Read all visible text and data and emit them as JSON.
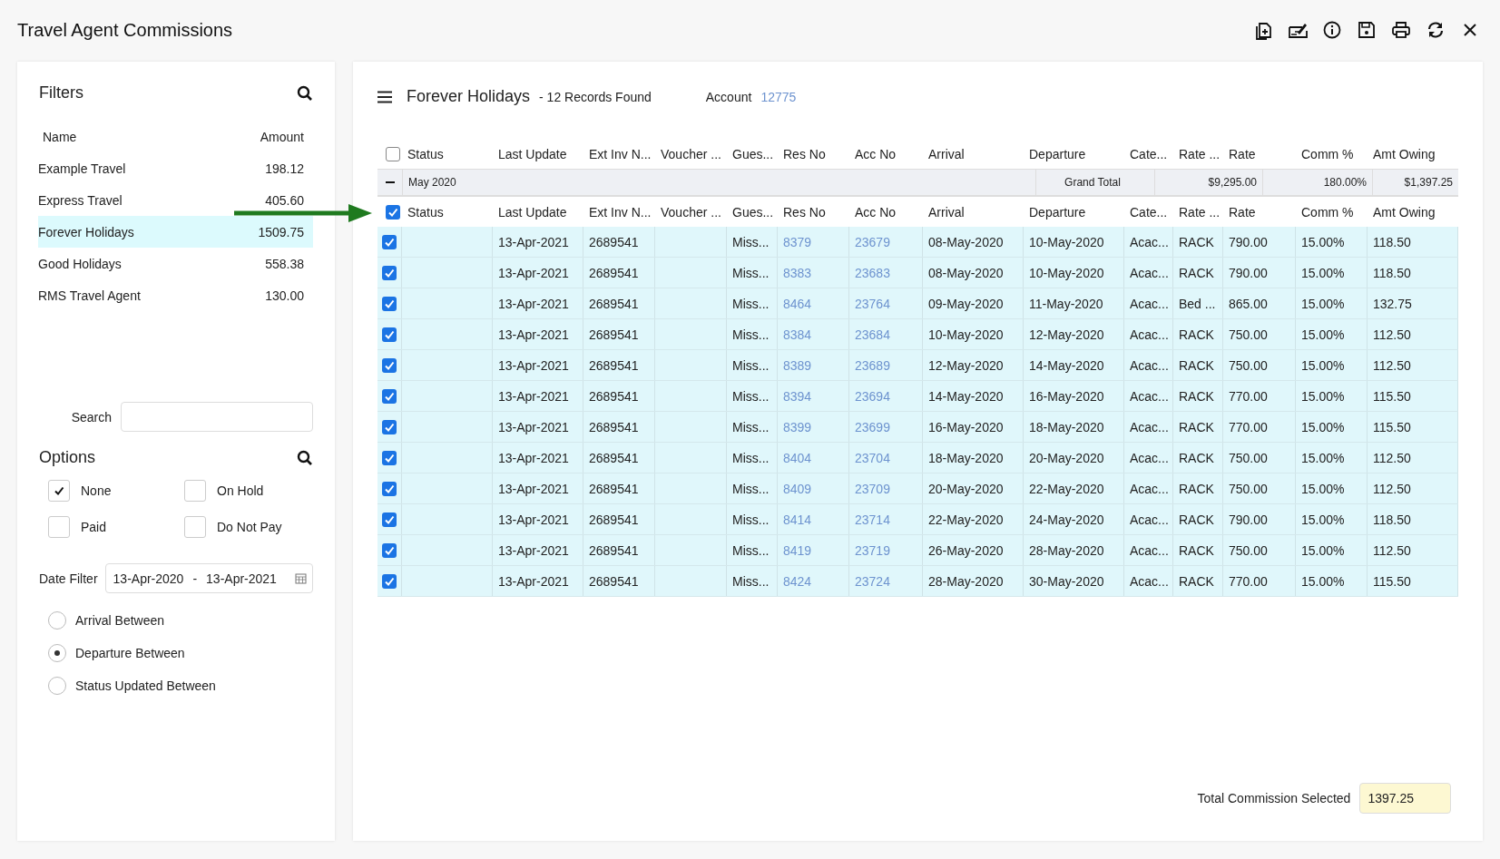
{
  "window": {
    "title": "Travel Agent Commissions"
  },
  "filters": {
    "title": "Filters",
    "columns": [
      "Name",
      "Amount"
    ],
    "items": [
      {
        "name": "Example Travel",
        "amount": "198.12",
        "selected": false
      },
      {
        "name": "Express Travel",
        "amount": "405.60",
        "selected": false
      },
      {
        "name": "Forever Holidays",
        "amount": "1509.75",
        "selected": true
      },
      {
        "name": "Good Holidays",
        "amount": "558.38",
        "selected": false
      },
      {
        "name": "RMS Travel Agent",
        "amount": "130.00",
        "selected": false
      }
    ],
    "search": {
      "label": "Search"
    },
    "options": {
      "title": "Options",
      "items": [
        {
          "label": "None",
          "checked": true
        },
        {
          "label": "On Hold",
          "checked": false
        },
        {
          "label": "Paid",
          "checked": false
        },
        {
          "label": "Do Not Pay",
          "checked": false
        }
      ]
    },
    "date_filter": {
      "label": "Date Filter",
      "from": "13-Apr-2020",
      "separator": "-",
      "to": "13-Apr-2021"
    },
    "date_modes": [
      {
        "label": "Arrival Between",
        "selected": false
      },
      {
        "label": "Departure Between",
        "selected": true
      },
      {
        "label": "Status Updated Between",
        "selected": false
      }
    ]
  },
  "main": {
    "title": "Forever Holidays",
    "subtitle": "- 12 Records Found",
    "account_label": "Account",
    "account_value": "12775"
  },
  "table": {
    "header_checked": false,
    "columns": [
      "Status",
      "Last Update",
      "Ext Inv N...",
      "Voucher ...",
      "Gues...",
      "Res No",
      "Acc No",
      "Arrival",
      "Departure",
      "Cate...",
      "Rate ...",
      "Rate",
      "Comm %",
      "Amt Owing"
    ],
    "group": {
      "columns": [
        "Status",
        "Last Update",
        "Ext Inv N...",
        "Voucher ...",
        "Gues...",
        "Res No",
        "Acc No",
        "Arrival",
        "Departure",
        "Cate...",
        "Rate ...",
        "Rate",
        "Comm %",
        "Amt Owing"
      ],
      "label": "May 2020",
      "expanded": true,
      "checked": true,
      "grand_total_label": "Grand Total",
      "rate_total": "$9,295.00",
      "comm_total": "180.00%",
      "amt_total": "$1,397.25"
    },
    "rows": [
      {
        "checked": true,
        "last_update": "13-Apr-2021",
        "ext_inv": "2689541",
        "guest": "Miss...",
        "res_no": "8379",
        "acc_no": "23679",
        "arrival": "08-May-2020",
        "departure": "10-May-2020",
        "category": "Acac...",
        "rate_type": "RACK",
        "rate": "790.00",
        "comm": "15.00%",
        "amt": "118.50"
      },
      {
        "checked": true,
        "last_update": "13-Apr-2021",
        "ext_inv": "2689541",
        "guest": "Miss...",
        "res_no": "8383",
        "acc_no": "23683",
        "arrival": "08-May-2020",
        "departure": "10-May-2020",
        "category": "Acac...",
        "rate_type": "RACK",
        "rate": "790.00",
        "comm": "15.00%",
        "amt": "118.50"
      },
      {
        "checked": true,
        "last_update": "13-Apr-2021",
        "ext_inv": "2689541",
        "guest": "Miss...",
        "res_no": "8464",
        "acc_no": "23764",
        "arrival": "09-May-2020",
        "departure": "11-May-2020",
        "category": "Acac...",
        "rate_type": "Bed ...",
        "rate": "865.00",
        "comm": "15.00%",
        "amt": "132.75"
      },
      {
        "checked": true,
        "last_update": "13-Apr-2021",
        "ext_inv": "2689541",
        "guest": "Miss...",
        "res_no": "8384",
        "acc_no": "23684",
        "arrival": "10-May-2020",
        "departure": "12-May-2020",
        "category": "Acac...",
        "rate_type": "RACK",
        "rate": "750.00",
        "comm": "15.00%",
        "amt": "112.50"
      },
      {
        "checked": true,
        "last_update": "13-Apr-2021",
        "ext_inv": "2689541",
        "guest": "Miss...",
        "res_no": "8389",
        "acc_no": "23689",
        "arrival": "12-May-2020",
        "departure": "14-May-2020",
        "category": "Acac...",
        "rate_type": "RACK",
        "rate": "750.00",
        "comm": "15.00%",
        "amt": "112.50"
      },
      {
        "checked": true,
        "last_update": "13-Apr-2021",
        "ext_inv": "2689541",
        "guest": "Miss...",
        "res_no": "8394",
        "acc_no": "23694",
        "arrival": "14-May-2020",
        "departure": "16-May-2020",
        "category": "Acac...",
        "rate_type": "RACK",
        "rate": "770.00",
        "comm": "15.00%",
        "amt": "115.50"
      },
      {
        "checked": true,
        "last_update": "13-Apr-2021",
        "ext_inv": "2689541",
        "guest": "Miss...",
        "res_no": "8399",
        "acc_no": "23699",
        "arrival": "16-May-2020",
        "departure": "18-May-2020",
        "category": "Acac...",
        "rate_type": "RACK",
        "rate": "770.00",
        "comm": "15.00%",
        "amt": "115.50"
      },
      {
        "checked": true,
        "last_update": "13-Apr-2021",
        "ext_inv": "2689541",
        "guest": "Miss...",
        "res_no": "8404",
        "acc_no": "23704",
        "arrival": "18-May-2020",
        "departure": "20-May-2020",
        "category": "Acac...",
        "rate_type": "RACK",
        "rate": "750.00",
        "comm": "15.00%",
        "amt": "112.50"
      },
      {
        "checked": true,
        "last_update": "13-Apr-2021",
        "ext_inv": "2689541",
        "guest": "Miss...",
        "res_no": "8409",
        "acc_no": "23709",
        "arrival": "20-May-2020",
        "departure": "22-May-2020",
        "category": "Acac...",
        "rate_type": "RACK",
        "rate": "750.00",
        "comm": "15.00%",
        "amt": "112.50"
      },
      {
        "checked": true,
        "last_update": "13-Apr-2021",
        "ext_inv": "2689541",
        "guest": "Miss...",
        "res_no": "8414",
        "acc_no": "23714",
        "arrival": "22-May-2020",
        "departure": "24-May-2020",
        "category": "Acac...",
        "rate_type": "RACK",
        "rate": "790.00",
        "comm": "15.00%",
        "amt": "118.50"
      },
      {
        "checked": true,
        "last_update": "13-Apr-2021",
        "ext_inv": "2689541",
        "guest": "Miss...",
        "res_no": "8419",
        "acc_no": "23719",
        "arrival": "26-May-2020",
        "departure": "28-May-2020",
        "category": "Acac...",
        "rate_type": "RACK",
        "rate": "750.00",
        "comm": "15.00%",
        "amt": "112.50"
      },
      {
        "checked": true,
        "last_update": "13-Apr-2021",
        "ext_inv": "2689541",
        "guest": "Miss...",
        "res_no": "8424",
        "acc_no": "23724",
        "arrival": "28-May-2020",
        "departure": "30-May-2020",
        "category": "Acac...",
        "rate_type": "RACK",
        "rate": "770.00",
        "comm": "15.00%",
        "amt": "115.50"
      }
    ]
  },
  "footer": {
    "label": "Total Commission Selected",
    "value": "1397.25"
  }
}
